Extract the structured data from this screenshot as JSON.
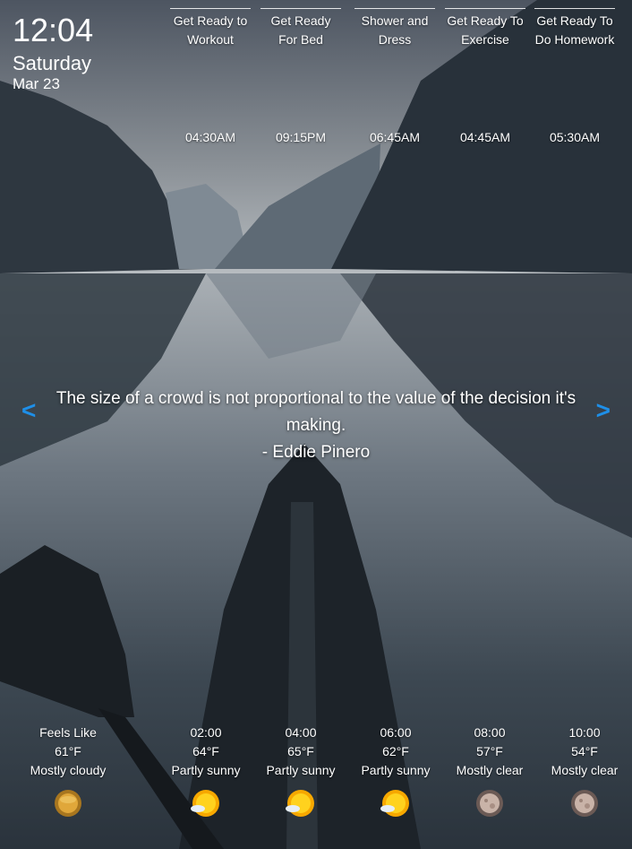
{
  "clock": {
    "time": "12:04",
    "day": "Saturday",
    "date": "Mar 23"
  },
  "routines": [
    {
      "name": "Get Ready to Workout",
      "time": "04:30AM"
    },
    {
      "name": "Get Ready For Bed",
      "time": "09:15PM"
    },
    {
      "name": "Shower and Dress",
      "time": "06:45AM"
    },
    {
      "name": "Get Ready To Exercise",
      "time": "04:45AM"
    },
    {
      "name": "Get Ready To Do Homework",
      "time": "05:30AM"
    }
  ],
  "quote": {
    "text": "The size of a crowd is not proportional to the value of the decision it's making.",
    "author": "- Eddie Pinero",
    "prev": "<",
    "next": ">"
  },
  "weather": [
    {
      "label": "Feels Like",
      "temp": "61°F",
      "condition": "Mostly cloudy",
      "icon": "cloudy-sun-icon"
    },
    {
      "label": "02:00",
      "temp": "64°F",
      "condition": "Partly sunny",
      "icon": "partly-sunny-icon"
    },
    {
      "label": "04:00",
      "temp": "65°F",
      "condition": "Partly sunny",
      "icon": "partly-sunny-icon"
    },
    {
      "label": "06:00",
      "temp": "62°F",
      "condition": "Partly sunny",
      "icon": "partly-sunny-icon"
    },
    {
      "label": "08:00",
      "temp": "57°F",
      "condition": "Mostly clear",
      "icon": "moon-icon"
    },
    {
      "label": "10:00",
      "temp": "54°F",
      "condition": "Mostly clear",
      "icon": "moon-icon"
    }
  ],
  "colors": {
    "accent": "#1e8fe8",
    "text": "#ffffff"
  }
}
